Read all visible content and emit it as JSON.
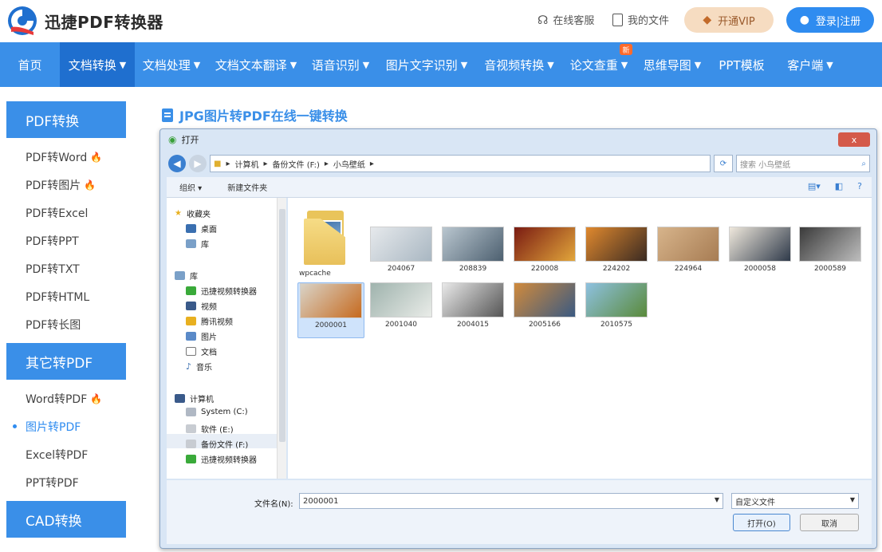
{
  "header": {
    "brand": "迅捷PDF转换器",
    "online_service": "在线客服",
    "my_files": "我的文件",
    "vip": "开通VIP",
    "login": "登录|注册"
  },
  "nav": {
    "items": [
      {
        "label": "首页",
        "caret": false
      },
      {
        "label": "文档转换",
        "caret": true
      },
      {
        "label": "文档处理",
        "caret": true
      },
      {
        "label": "文档文本翻译",
        "caret": true
      },
      {
        "label": "语音识别",
        "caret": true
      },
      {
        "label": "图片文字识别",
        "caret": true
      },
      {
        "label": "音视频转换",
        "caret": true
      },
      {
        "label": "论文查重",
        "caret": true
      },
      {
        "label": "思维导图",
        "caret": true
      },
      {
        "label": "PPT模板",
        "caret": false
      },
      {
        "label": "客户端",
        "caret": true
      }
    ],
    "badge": "新"
  },
  "sidebar": {
    "group1": {
      "heading": "PDF转换",
      "items": [
        "PDF转Word",
        "PDF转图片",
        "PDF转Excel",
        "PDF转PPT",
        "PDF转TXT",
        "PDF转HTML",
        "PDF转长图"
      ]
    },
    "group2": {
      "heading": "其它转PDF",
      "items": [
        "Word转PDF",
        "图片转PDF",
        "Excel转PDF",
        "PPT转PDF"
      ]
    },
    "group3": {
      "heading": "CAD转换"
    }
  },
  "content": {
    "title": "JPG图片转PDF在线一键转换"
  },
  "dialog": {
    "title": "打开",
    "close": "x",
    "breadcrumb": [
      "计算机",
      "备份文件 (F:)",
      "小鸟壁纸"
    ],
    "search_placeholder": "搜索 小鸟壁纸",
    "organize": "组织 ▾",
    "new_folder": "新建文件夹",
    "tree": {
      "favorites": "收藏夹",
      "desktop": "桌面",
      "library_small": "库",
      "libraries": "库",
      "lib_items": [
        "迅捷视频转换器",
        "视频",
        "腾讯视频",
        "图片",
        "文档",
        "音乐"
      ],
      "computer": "计算机",
      "drives": [
        "System (C:)",
        "软件 (E:)",
        "备份文件 (F:)"
      ],
      "last_item": "迅捷视频转换器"
    },
    "folder_name": "wpcache",
    "files": [
      {
        "name": "204067",
        "colors": [
          "#e6e9ec",
          "#a9b7c2"
        ]
      },
      {
        "name": "208839",
        "colors": [
          "#b9c6cf",
          "#4d6070"
        ]
      },
      {
        "name": "220008",
        "colors": [
          "#7a1b12",
          "#e2a63b"
        ]
      },
      {
        "name": "224202",
        "colors": [
          "#e0892e",
          "#3a2a22"
        ]
      },
      {
        "name": "224964",
        "colors": [
          "#d7b48b",
          "#a77c53"
        ]
      },
      {
        "name": "2000058",
        "colors": [
          "#efe8dc",
          "#2f3a4a"
        ]
      },
      {
        "name": "2000589",
        "colors": [
          "#3a3a3a",
          "#bdbdbd"
        ]
      },
      {
        "name": "2000001",
        "colors": [
          "#d9d3c7",
          "#c66a1f"
        ]
      },
      {
        "name": "2001040",
        "colors": [
          "#9fb3ad",
          "#e9ece8"
        ]
      },
      {
        "name": "2004015",
        "colors": [
          "#e9e9e9",
          "#555"
        ]
      },
      {
        "name": "2005166",
        "colors": [
          "#d08a3c",
          "#3a5a82"
        ]
      },
      {
        "name": "2010575",
        "colors": [
          "#8ec1e0",
          "#5a8a3a"
        ]
      }
    ],
    "filename_label": "文件名(N):",
    "filename_value": "2000001",
    "filetype": "自定义文件",
    "open_btn": "打开(O)",
    "cancel_btn": "取消"
  },
  "colors": {
    "primary": "#3a8fe8",
    "active_nav": "#1f6fcf",
    "vip_bg": "#f6dcc1",
    "fire": "#ff7a1a"
  }
}
